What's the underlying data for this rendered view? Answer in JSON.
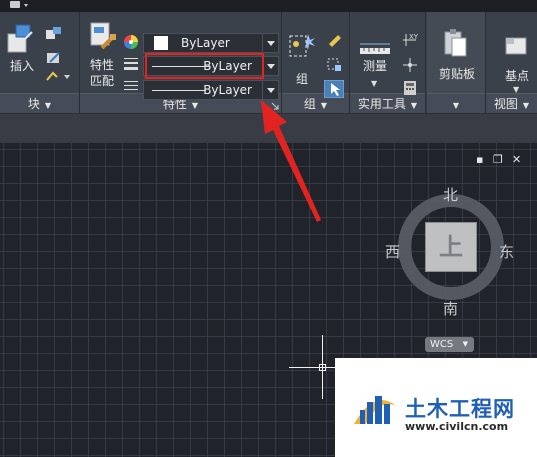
{
  "ribbon": {
    "block_panel": {
      "insert_label": "插入",
      "title": "块"
    },
    "properties_panel": {
      "match_label_1": "特性",
      "match_label_2": "匹配",
      "color_value": "ByLayer",
      "linetype_value": "ByLayer",
      "lineweight_value": "ByLayer",
      "title": "特性"
    },
    "group_panel": {
      "group_label": "组",
      "title": "组"
    },
    "utilities_panel": {
      "measure_label": "测量",
      "title": "实用工具"
    },
    "clipboard_panel": {
      "clipboard_label": "剪贴板"
    },
    "view_panel": {
      "base_label": "基点",
      "title": "视图"
    }
  },
  "viewcube": {
    "north": "北",
    "south": "南",
    "east": "东",
    "west": "西",
    "face": "上",
    "wcs_label": "WCS"
  },
  "watermark": {
    "title": "土木工程网",
    "url": "www.civilcn.com"
  },
  "colors": {
    "ribbon_bg": "#3b414b",
    "canvas_bg": "#20232a",
    "highlight": "#e3231f",
    "watermark_blue": "#1f5fb5"
  }
}
